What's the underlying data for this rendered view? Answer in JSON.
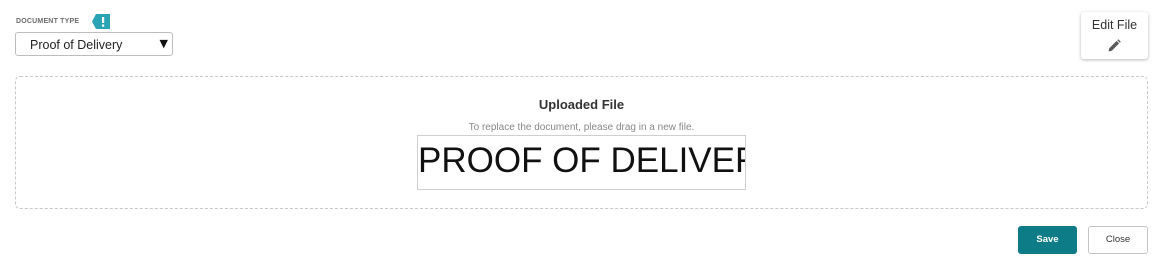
{
  "document_type": {
    "label": "DOCUMENT TYPE",
    "required_icon": "exclamation-flag-icon",
    "required_icon_color": "#2aa3b5",
    "selected_value": "Proof of Delivery",
    "caret_icon": "caret-down-icon"
  },
  "edit_file": {
    "label": "Edit File",
    "icon": "pencil-icon"
  },
  "upload": {
    "title": "Uploaded File",
    "instruction": "To replace the document, please drag in a new file.",
    "preview_text": "PROOF OF DELIVERY"
  },
  "actions": {
    "save_label": "Save",
    "close_label": "Close",
    "save_color": "#0e7c86"
  }
}
